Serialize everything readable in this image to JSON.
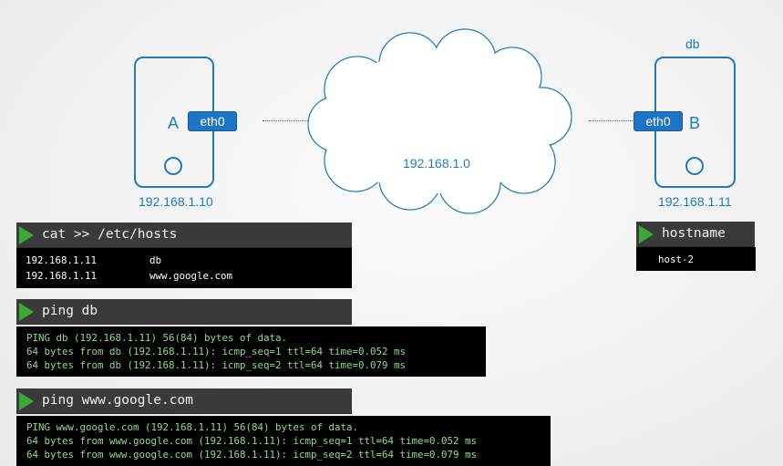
{
  "hostA": {
    "label": "A",
    "ip": "192.168.1.10",
    "interface": "eth0"
  },
  "hostB": {
    "label": "B",
    "ip": "192.168.1.11",
    "interface": "eth0",
    "hostname_label": "db"
  },
  "network": {
    "label": "192.168.1.0"
  },
  "hosts_file": {
    "command": "cat >> /etc/hosts",
    "entries": [
      {
        "ip": "192.168.1.11",
        "name": "db"
      },
      {
        "ip": "192.168.1.11",
        "name": "www.google.com"
      }
    ]
  },
  "hostname_cmd": {
    "command": "hostname",
    "output": "host-2"
  },
  "ping_db": {
    "command": "ping db",
    "lines": [
      "PING db (192.168.1.11) 56(84) bytes of data.",
      "64 bytes from db (192.168.1.11): icmp_seq=1 ttl=64 time=0.052 ms",
      "64 bytes from db (192.168.1.11): icmp_seq=2 ttl=64 time=0.079 ms"
    ]
  },
  "ping_google": {
    "command": "ping www.google.com",
    "lines": [
      "PING www.google.com (192.168.1.11) 56(84) bytes of data.",
      "64 bytes from www.google.com (192.168.1.11): icmp_seq=1 ttl=64 time=0.052 ms",
      "64 bytes from www.google.com (192.168.1.11): icmp_seq=2 ttl=64 time=0.079 ms"
    ]
  },
  "colors": {
    "accent": "#1f7bc1",
    "play": "#3aa935",
    "terminal_bg": "#000000",
    "bar_bg": "#3a3a3a",
    "ping_text": "#8fdc87"
  }
}
